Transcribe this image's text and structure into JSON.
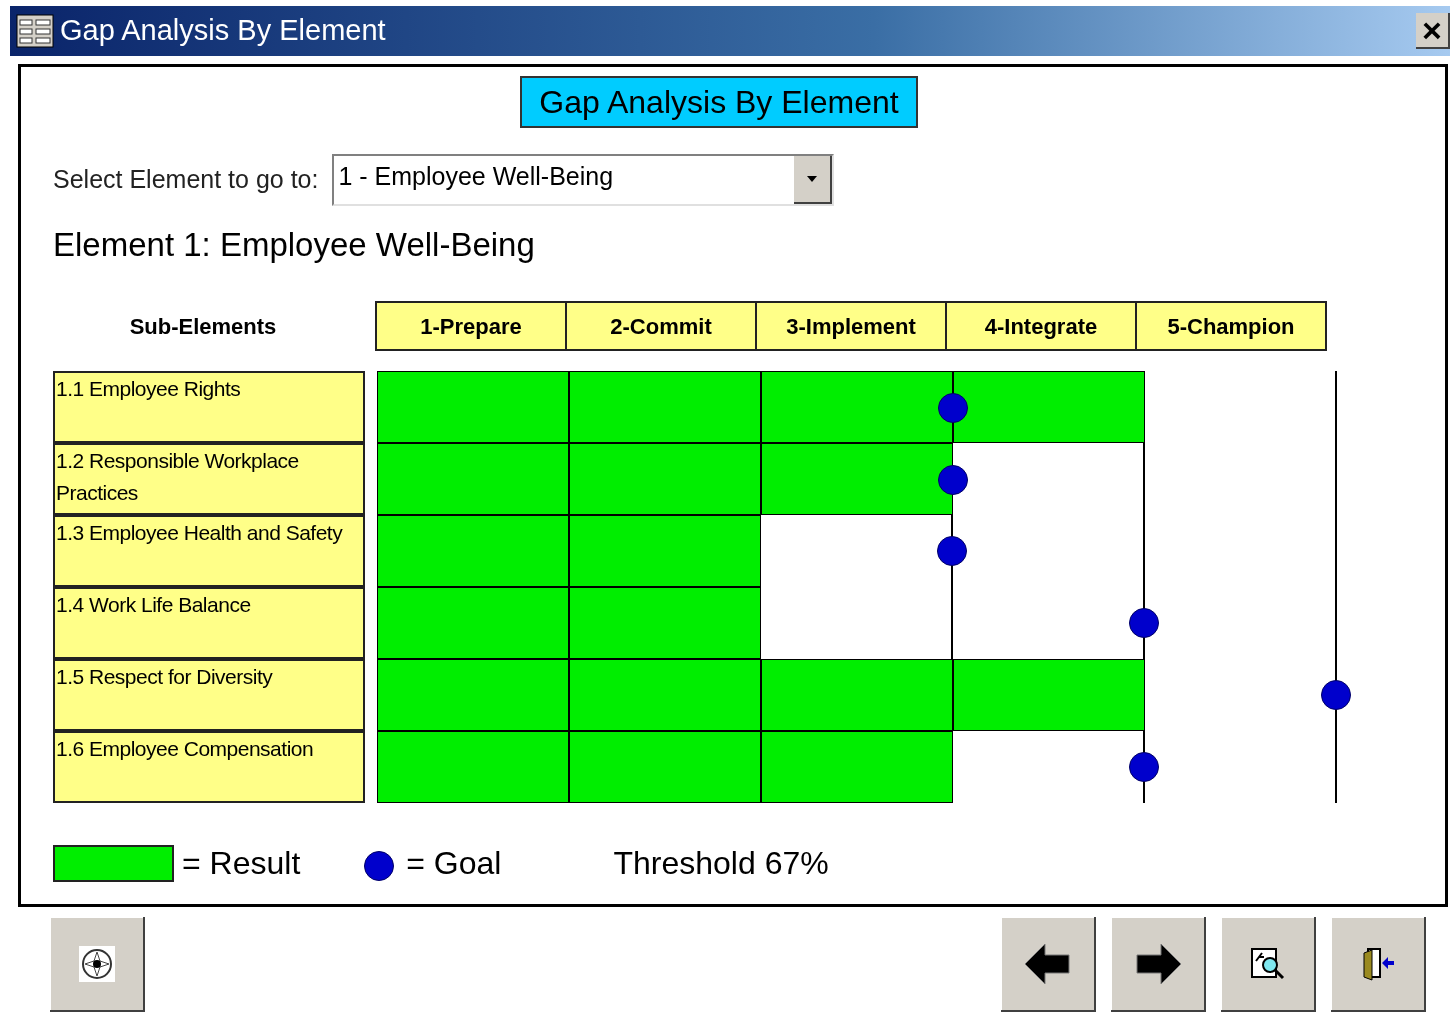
{
  "window": {
    "title": "Gap Analysis By Element",
    "close": "×"
  },
  "heading": "Gap Analysis By Element",
  "selector": {
    "label": "Select Element to go to:",
    "value": "1 - Employee Well-Being"
  },
  "element_title": "Element 1: Employee Well-Being",
  "grid": {
    "row_header": "Sub-Elements",
    "stages": [
      "1-Prepare",
      "2-Commit",
      "3-Implement",
      "4-Integrate",
      "5-Champion"
    ],
    "rows": [
      {
        "name": "1.1 Employee Rights",
        "cells": [
          {
            "result": true,
            "goal": false
          },
          {
            "result": true,
            "goal": false
          },
          {
            "result": true,
            "goal": true
          },
          {
            "result": true,
            "goal": false
          },
          {
            "result": false,
            "goal": false
          }
        ]
      },
      {
        "name": "1.2 Responsible Workplace Practices",
        "cells": [
          {
            "result": true,
            "goal": false
          },
          {
            "result": true,
            "goal": false
          },
          {
            "result": true,
            "goal": true
          },
          {
            "result": false,
            "goal": false
          },
          {
            "result": false,
            "goal": false
          }
        ]
      },
      {
        "name": "1.3 Employee Health and Safety",
        "cells": [
          {
            "result": true,
            "goal": false
          },
          {
            "result": true,
            "goal": false
          },
          {
            "result": false,
            "goal": true
          },
          {
            "result": false,
            "goal": false
          },
          {
            "result": false,
            "goal": false
          }
        ]
      },
      {
        "name": "1.4 Work Life Balance",
        "cells": [
          {
            "result": true,
            "goal": false
          },
          {
            "result": true,
            "goal": false
          },
          {
            "result": false,
            "goal": false
          },
          {
            "result": false,
            "goal": true
          },
          {
            "result": false,
            "goal": false
          }
        ]
      },
      {
        "name": "1.5 Respect for Diversity",
        "cells": [
          {
            "result": true,
            "goal": false
          },
          {
            "result": true,
            "goal": false
          },
          {
            "result": true,
            "goal": false
          },
          {
            "result": true,
            "goal": false
          },
          {
            "result": false,
            "goal": true
          }
        ]
      },
      {
        "name": "1.6 Employee Compensation",
        "cells": [
          {
            "result": true,
            "goal": false
          },
          {
            "result": true,
            "goal": false
          },
          {
            "result": true,
            "goal": false
          },
          {
            "result": false,
            "goal": true
          },
          {
            "result": false,
            "goal": false
          }
        ]
      }
    ]
  },
  "legend": {
    "result_label": "= Result",
    "goal_label": "= Goal",
    "threshold": "Threshold 67%"
  }
}
